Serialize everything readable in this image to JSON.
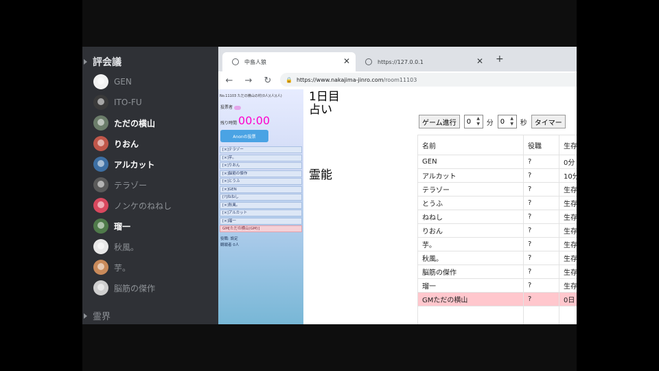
{
  "voice": {
    "channel_name": "評会議",
    "next_channel_name": "霊界",
    "members": [
      {
        "name": "GEN",
        "avatar_color": "#f2f2f2",
        "state": "dim"
      },
      {
        "name": "ITO-FU",
        "avatar_color": "#3a3a3a",
        "state": "dim"
      },
      {
        "name": "ただの横山",
        "avatar_color": "#6b7d6a",
        "state": "active"
      },
      {
        "name": "りおん",
        "avatar_color": "#c0574a",
        "state": "active"
      },
      {
        "name": "アルカット",
        "avatar_color": "#3d6fa3",
        "state": "active"
      },
      {
        "name": "テラゾー",
        "avatar_color": "#5a5a5a",
        "state": "dim"
      },
      {
        "name": "ノンケのねねし",
        "avatar_color": "#d9485e",
        "state": "dim"
      },
      {
        "name": "瑠一",
        "avatar_color": "#4f7a4a",
        "state": "active"
      },
      {
        "name": "秋風。",
        "avatar_color": "#e8e8e8",
        "state": "dim"
      },
      {
        "name": "芋。",
        "avatar_color": "#c98a5a",
        "state": "dim"
      },
      {
        "name": "脳筋の傑作",
        "avatar_color": "#cfcfcf",
        "state": "dim"
      }
    ]
  },
  "browser": {
    "tabs": [
      {
        "title": "中島人狼",
        "active": true
      },
      {
        "title": "https://127.0.0.1",
        "active": false
      }
    ],
    "new_tab_label": "+",
    "url": "https://www.nakajima-jinro.com/room11103",
    "url_host": "https://www.nakajima-jinro.com",
    "url_path": "/room11103"
  },
  "page": {
    "room_line": "No.11103 ただの横山の村(0人)(人)(人)",
    "status_label": "投票者",
    "remain_label": "残り時間",
    "remain_value": "00:00",
    "vote_button": "Anonの投票",
    "players_side": [
      "[×]テラゾー",
      "[×]芋。",
      "[×]りおん",
      "[×]脳筋の傑作",
      "[×]とうふ",
      "[×]GEN",
      "[?]ねねし",
      "[×]秋風。",
      "[×]アルカット",
      "[×]瑠一"
    ],
    "gm_side": "GM[ただの横山(GM)]",
    "footer_lines": [
      "役職: 設定",
      "観戦者 0人"
    ],
    "day_title": "1日目",
    "divine_title": "占い",
    "medium_title": "霊能",
    "controls": {
      "progress_button": "ゲーム進行",
      "minutes_value": "0",
      "minutes_unit": "分",
      "seconds_value": "0",
      "seconds_unit": "秒",
      "timer_button": "タイマー"
    },
    "table": {
      "headers": [
        "名前",
        "役職",
        "生存"
      ],
      "rows": [
        {
          "name": "GEN",
          "role": "?",
          "status": "0分",
          "gm": false
        },
        {
          "name": "アルカット",
          "role": "?",
          "status": "10分",
          "gm": false
        },
        {
          "name": "テラゾー",
          "role": "?",
          "status": "生存",
          "gm": false
        },
        {
          "name": "とうふ",
          "role": "?",
          "status": "生存",
          "gm": false
        },
        {
          "name": "ねねし",
          "role": "?",
          "status": "生存",
          "gm": false
        },
        {
          "name": "りおん",
          "role": "?",
          "status": "生存",
          "gm": false
        },
        {
          "name": "芋。",
          "role": "?",
          "status": "生存",
          "gm": false
        },
        {
          "name": "秋風。",
          "role": "?",
          "status": "生存",
          "gm": false
        },
        {
          "name": "脳筋の傑作",
          "role": "?",
          "status": "生存",
          "gm": false
        },
        {
          "name": "瑠一",
          "role": "?",
          "status": "生存",
          "gm": false
        },
        {
          "name": "GMただの横山",
          "role": "?",
          "status": "0日",
          "gm": true
        }
      ]
    }
  }
}
